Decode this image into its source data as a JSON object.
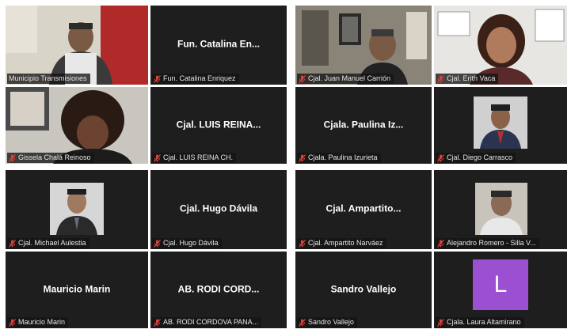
{
  "meeting": {
    "tiles": [
      {
        "name_center": "",
        "label": "Municipio Transmisiones"
      },
      {
        "name_center": "Fun. Catalina En...",
        "label": "Fun. Catalina Enriquez"
      },
      {
        "name_center": "",
        "label": "Gissela Chalá Reinoso"
      },
      {
        "name_center": "Cjal. LUIS REINA...",
        "label": "Cjal. LUIS REINA CH."
      },
      {
        "name_center": "",
        "label": "Cjal. Juan Manuel Carrión"
      },
      {
        "name_center": "",
        "label": "Cjal. Erith Vaca"
      },
      {
        "name_center": "Cjala. Paulina Iz...",
        "label": "Cjala. Paulina Izurieta"
      },
      {
        "name_center": "",
        "label": "Cjal. Diego Carrasco"
      },
      {
        "name_center": "",
        "label": "Cjal. Michael Aulestia"
      },
      {
        "name_center": "Cjal. Hugo Dávila",
        "label": "Cjal. Hugo Dávila"
      },
      {
        "name_center": "Mauricio Marin",
        "label": "Mauricio Marin"
      },
      {
        "name_center": "AB. RODI CORD...",
        "label": "AB. RODI CORDOVA PANA..."
      },
      {
        "name_center": "Cjal. Ampartito...",
        "label": "Cjal. Ampartito Narváez"
      },
      {
        "name_center": "",
        "label": "Alejandro Romero - Silla V..."
      },
      {
        "name_center": "Sandro Vallejo",
        "label": "Sandro Vallejo"
      },
      {
        "name_center": "",
        "label": "Cjala. Laura Altamirano",
        "avatar_letter": "L"
      }
    ],
    "colors": {
      "tile_bg": "#1e1e1e",
      "active_speaker_border": "#c8e63c",
      "muted_mic": "#e0403a",
      "avatar_purple": "#9b4fd1"
    }
  }
}
